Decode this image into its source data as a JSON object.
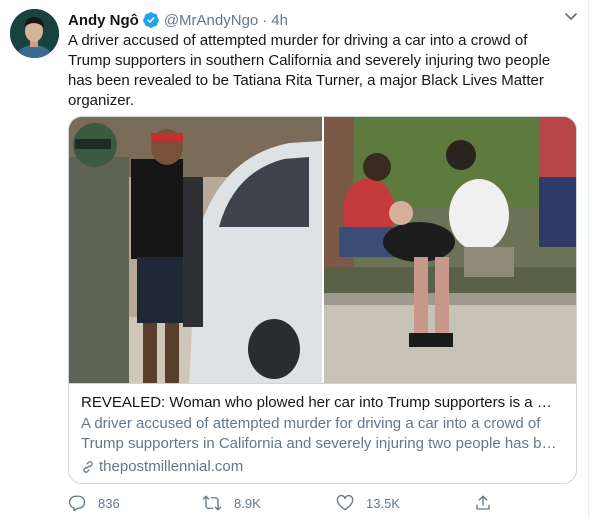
{
  "tweet": {
    "author_name": "Andy Ngô",
    "handle": "@MrAndyNgo",
    "separator": "·",
    "time": "4h",
    "text": "A driver accused of attempted murder for driving a car into a crowd of Trump supporters in southern California and severely injuring two people has been revealed to be Tatiana Rita Turner, a major Black Lives Matter organizer."
  },
  "card": {
    "title": "REVEALED: Woman who plowed her car into Trump supporters is a majo...",
    "description_line1": "A driver accused of attempted murder for driving a car into a crowd of",
    "description_line2": "Trump supporters in California and severely injuring two people has bee...",
    "domain": "thepostmillennial.com"
  },
  "actions": {
    "reply_count": "836",
    "retweet_count": "8.9K",
    "like_count": "13.5K"
  },
  "icons": {
    "verified": "verified-badge-icon",
    "caret": "chevron-down-icon",
    "link": "link-icon",
    "reply": "reply-icon",
    "retweet": "retweet-icon",
    "like": "heart-icon",
    "share": "share-icon"
  },
  "colors": {
    "text_primary": "#14171a",
    "text_secondary": "#657786",
    "verified_blue": "#1da1f2",
    "border": "#ccd6dd"
  }
}
